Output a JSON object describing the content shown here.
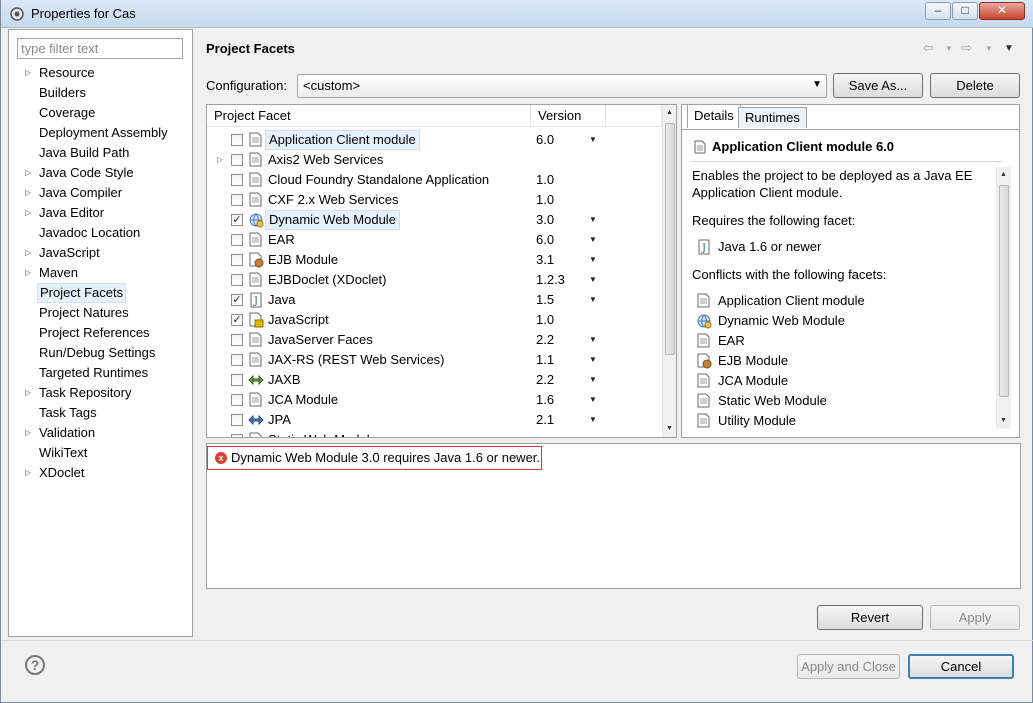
{
  "window": {
    "title": "Properties for Cas",
    "icons": {
      "app": "gear-icon",
      "minimize": "minimize-icon",
      "maximize": "maximize-icon",
      "close": "close-icon"
    }
  },
  "sidebar": {
    "filter_placeholder": "type filter text",
    "items": [
      {
        "label": "Resource",
        "expandable": true
      },
      {
        "label": "Builders",
        "expandable": false
      },
      {
        "label": "Coverage",
        "expandable": false
      },
      {
        "label": "Deployment Assembly",
        "expandable": false
      },
      {
        "label": "Java Build Path",
        "expandable": false
      },
      {
        "label": "Java Code Style",
        "expandable": true
      },
      {
        "label": "Java Compiler",
        "expandable": true
      },
      {
        "label": "Java Editor",
        "expandable": true
      },
      {
        "label": "Javadoc Location",
        "expandable": false
      },
      {
        "label": "JavaScript",
        "expandable": true
      },
      {
        "label": "Maven",
        "expandable": true
      },
      {
        "label": "Project Facets",
        "expandable": false,
        "selected": true
      },
      {
        "label": "Project Natures",
        "expandable": false
      },
      {
        "label": "Project References",
        "expandable": false
      },
      {
        "label": "Run/Debug Settings",
        "expandable": false
      },
      {
        "label": "Targeted Runtimes",
        "expandable": false
      },
      {
        "label": "Task Repository",
        "expandable": true
      },
      {
        "label": "Task Tags",
        "expandable": false
      },
      {
        "label": "Validation",
        "expandable": true
      },
      {
        "label": "WikiText",
        "expandable": false
      },
      {
        "label": "XDoclet",
        "expandable": true
      }
    ]
  },
  "page": {
    "title": "Project Facets"
  },
  "configuration": {
    "label": "Configuration:",
    "value": "<custom>",
    "save_as": "Save As...",
    "delete": "Delete"
  },
  "facets": {
    "headers": {
      "facet": "Project Facet",
      "version": "Version"
    },
    "rows": [
      {
        "name": "Application Client module",
        "version": "6.0",
        "checked": false,
        "dropdown": true,
        "icon": "document-icon",
        "selected": true,
        "expandable": false
      },
      {
        "name": "Axis2 Web Services",
        "version": "",
        "checked": false,
        "dropdown": false,
        "icon": "document-icon",
        "selected": false,
        "expandable": true
      },
      {
        "name": "Cloud Foundry Standalone Application",
        "version": "1.0",
        "checked": false,
        "dropdown": false,
        "icon": "document-icon",
        "selected": false,
        "expandable": false
      },
      {
        "name": "CXF 2.x Web Services",
        "version": "1.0",
        "checked": false,
        "dropdown": false,
        "icon": "document-icon",
        "selected": false,
        "expandable": false
      },
      {
        "name": "Dynamic Web Module",
        "version": "3.0",
        "checked": true,
        "dropdown": true,
        "icon": "web-module-icon",
        "selected": true,
        "expandable": false
      },
      {
        "name": "EAR",
        "version": "6.0",
        "checked": false,
        "dropdown": true,
        "icon": "document-icon",
        "selected": false,
        "expandable": false
      },
      {
        "name": "EJB Module",
        "version": "3.1",
        "checked": false,
        "dropdown": true,
        "icon": "ejb-icon",
        "selected": false,
        "expandable": false
      },
      {
        "name": "EJBDoclet (XDoclet)",
        "version": "1.2.3",
        "checked": false,
        "dropdown": true,
        "icon": "document-icon",
        "selected": false,
        "expandable": false
      },
      {
        "name": "Java",
        "version": "1.5",
        "checked": true,
        "dropdown": true,
        "icon": "java-icon",
        "selected": false,
        "expandable": false
      },
      {
        "name": "JavaScript",
        "version": "1.0",
        "checked": true,
        "dropdown": false,
        "icon": "javascript-icon",
        "selected": false,
        "expandable": false
      },
      {
        "name": "JavaServer Faces",
        "version": "2.2",
        "checked": false,
        "dropdown": true,
        "icon": "document-icon",
        "selected": false,
        "expandable": false
      },
      {
        "name": "JAX-RS (REST Web Services)",
        "version": "1.1",
        "checked": false,
        "dropdown": true,
        "icon": "document-icon",
        "selected": false,
        "expandable": false
      },
      {
        "name": "JAXB",
        "version": "2.2",
        "checked": false,
        "dropdown": true,
        "icon": "jaxb-icon",
        "selected": false,
        "expandable": false
      },
      {
        "name": "JCA Module",
        "version": "1.6",
        "checked": false,
        "dropdown": true,
        "icon": "document-icon",
        "selected": false,
        "expandable": false
      },
      {
        "name": "JPA",
        "version": "2.1",
        "checked": false,
        "dropdown": true,
        "icon": "jpa-icon",
        "selected": false,
        "expandable": false
      },
      {
        "name": "Static Web Module",
        "version": "",
        "checked": false,
        "dropdown": false,
        "icon": "document-icon",
        "selected": false,
        "expandable": false
      }
    ]
  },
  "details": {
    "tabs": [
      "Details",
      "Runtimes"
    ],
    "title": "Application Client module 6.0",
    "description": "Enables the project to be deployed as a Java EE Application Client module.",
    "requires_label": "Requires the following facet:",
    "requires": [
      {
        "name": "Java 1.6 or newer",
        "icon": "java-icon"
      }
    ],
    "conflicts_label": "Conflicts with the following facets:",
    "conflicts": [
      {
        "name": "Application Client module",
        "icon": "document-icon"
      },
      {
        "name": "Dynamic Web Module",
        "icon": "web-module-icon"
      },
      {
        "name": "EAR",
        "icon": "document-icon"
      },
      {
        "name": "EJB Module",
        "icon": "ejb-icon"
      },
      {
        "name": "JCA Module",
        "icon": "document-icon"
      },
      {
        "name": "Static Web Module",
        "icon": "document-icon"
      },
      {
        "name": "Utility Module",
        "icon": "document-icon"
      }
    ]
  },
  "message": {
    "text": "Dynamic Web Module 3.0 requires Java 1.6 or newer.",
    "icon": "error-icon"
  },
  "buttons": {
    "revert": "Revert",
    "apply": "Apply",
    "apply_close": "Apply and Close",
    "cancel": "Cancel"
  },
  "help": {
    "label": "?"
  }
}
